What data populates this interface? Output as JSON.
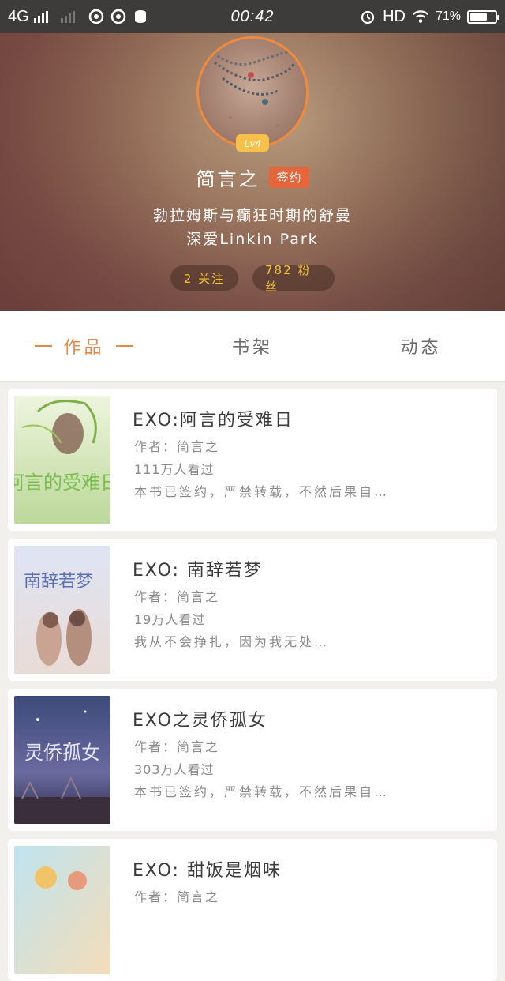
{
  "status_bar": {
    "network": "4G",
    "time": "00:42",
    "hd": "HD",
    "battery": "71%",
    "battery_level": 0.71
  },
  "profile": {
    "level": "Lv4",
    "name": "简言之",
    "signed_badge": "签约",
    "bio_line1": "勃拉姆斯与癫狂时期的舒曼",
    "bio_line2": "深爱Linkin Park",
    "following": "2 关注",
    "followers": "782 粉丝"
  },
  "tabs": {
    "works": "作品",
    "bookshelf": "书架",
    "activity": "动态"
  },
  "books": [
    {
      "title": "EXO:阿言的受难日",
      "author": "作者：简言之",
      "views": "111万人看过",
      "desc": "本书已签约，严禁转载，不然后果自…",
      "cover_text": "阿言的受难日"
    },
    {
      "title": "EXO: 南辞若梦",
      "author": "作者：简言之",
      "views": "19万人看过",
      "desc": "我从不会挣扎，因为我无处…",
      "cover_text": "南辞若梦"
    },
    {
      "title": "EXO之灵侨孤女",
      "author": "作者：简言之",
      "views": "303万人看过",
      "desc": "本书已签约，严禁转载，不然后果自…",
      "cover_text": "灵侨孤女"
    },
    {
      "title": "EXO: 甜饭是烟味",
      "author": "作者：简言之",
      "views": "",
      "desc": "",
      "cover_text": ""
    }
  ]
}
